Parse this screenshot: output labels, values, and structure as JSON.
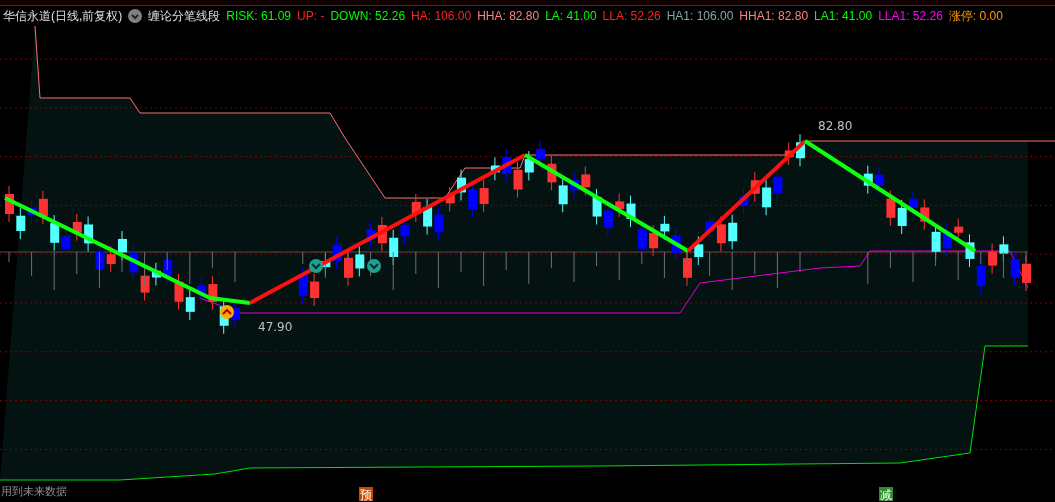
{
  "title": "华信永道(日线,前复权)",
  "indicator": "缠论分笔线段",
  "legend": [
    {
      "text": "RISK: 61.09",
      "color": "#00ff00"
    },
    {
      "text": "UP: -",
      "color": "#ff2020"
    },
    {
      "text": "DOWN: 52.26",
      "color": "#00ff00"
    },
    {
      "text": "HA: 106.00",
      "color": "#ff2020"
    },
    {
      "text": "HHA: 82.80",
      "color": "#ff8080"
    },
    {
      "text": "LA: 41.00",
      "color": "#00ff00"
    },
    {
      "text": "LLA: 52.26",
      "color": "#ff2020"
    },
    {
      "text": "HA1: 106.00",
      "color": "#80a8a8"
    },
    {
      "text": "HHA1: 82.80",
      "color": "#ff8080"
    },
    {
      "text": "LA1: 41.00",
      "color": "#00ff00"
    },
    {
      "text": "LLA1: 52.26",
      "color": "#ff00ff"
    },
    {
      "text": "涨停: 0.00",
      "color": "#ff9900"
    }
  ],
  "chart": {
    "price_labels": [
      {
        "text": "82.80",
        "kind": "high"
      },
      {
        "text": "47.90",
        "kind": "low"
      }
    ],
    "signals": [
      {
        "text": "预",
        "color": "#c84800"
      },
      {
        "text": "减",
        "color": "#2e8b2e"
      }
    ],
    "note": "用到未来数据"
  }
}
